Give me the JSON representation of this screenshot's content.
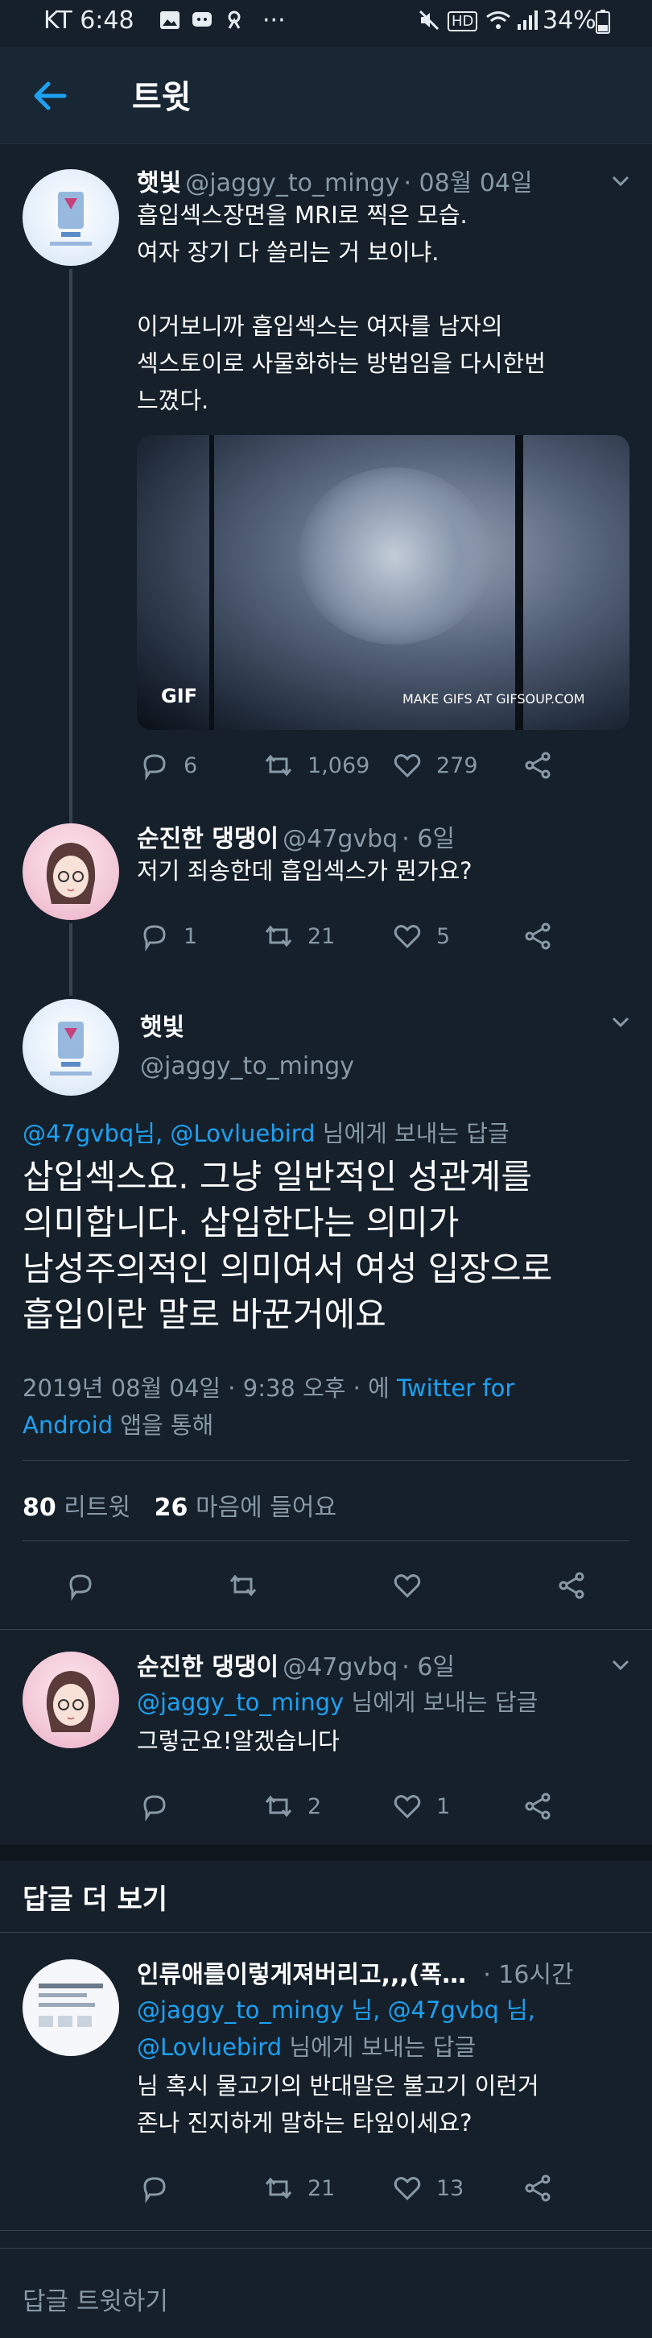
{
  "status_bar": {
    "carrier_time": "KT 6:48",
    "dots": "···",
    "battery": "34%"
  },
  "header": {
    "title": "트윗"
  },
  "tweet1": {
    "name": "햇빛",
    "handle": "@jaggy_to_mingy",
    "date": "· 08월 04일",
    "text": "흡입섹스장면을 MRI로 찍은 모습.\n여자 장기 다 쓸리는 거 보이냐.\n\n이거보니까 흡입섹스는 여자를 남자의\n섹스토이로 사물화하는 방법임을 다시한번\n느꼈다.",
    "gif_badge": "GIF",
    "gif_watermark": "MAKE GIFS AT GIFSOUP.COM",
    "replies": "6",
    "retweets": "1,069",
    "likes": "279"
  },
  "tweet2": {
    "name": "순진한 댕댕이",
    "handle": "@47gvbq",
    "date": "· 6일",
    "text": "저기 죄송한데 흡입섹스가 뭔가요?",
    "replies": "1",
    "retweets": "21",
    "likes": "5"
  },
  "main": {
    "name": "햇빛",
    "handle": "@jaggy_to_mingy",
    "reply_to": {
      "mention1": "@47gvbq",
      "mid": "님, ",
      "mention2": "@Lovluebird",
      "suffix": " 님에게 보내는 답글"
    },
    "text": "삽입섹스요. 그냥 일반적인 성관계를\n의미합니다. 삽입한다는 의미가\n남성주의적인 의미여서 여성 입장으로\n흡입이란 말로 바꾼거에요",
    "meta_time": "2019년 08월 04일 · 9:38 오후 · 에 ",
    "meta_source1": "Twitter for",
    "meta_source2": "Android",
    "meta_suffix": " 앱을 통해",
    "retweet_count": "80",
    "retweet_label": "리트윗",
    "like_count": "26",
    "like_label": "마음에 들어요"
  },
  "reply1": {
    "name": "순진한 댕댕이",
    "handle": "@47gvbq",
    "date": "· 6일",
    "reply_to_mention": "@jaggy_to_mingy",
    "reply_to_suffix": " 님에게 보내는 답글",
    "text": "그렇군요!알겠습니다",
    "replies": "",
    "retweets": "2",
    "likes": "1"
  },
  "more_replies": {
    "title": "답글 더 보기"
  },
  "reply2": {
    "name": "인류애를이렇게져버리고,,,(폭…",
    "date": "· 16시간",
    "reply_to_line1": "@jaggy_to_mingy 님, @47gvbq 님,",
    "reply_to_mention3": "@Lovluebird",
    "reply_to_suffix": " 님에게 보내는 답글",
    "text": "님 혹시 물고기의 반대말은 불고기 이런거\n존나 진지하게 말하는 타잎이세요?",
    "replies": "",
    "retweets": "21",
    "likes": "13"
  },
  "composer": {
    "placeholder": "답글 트윗하기"
  }
}
